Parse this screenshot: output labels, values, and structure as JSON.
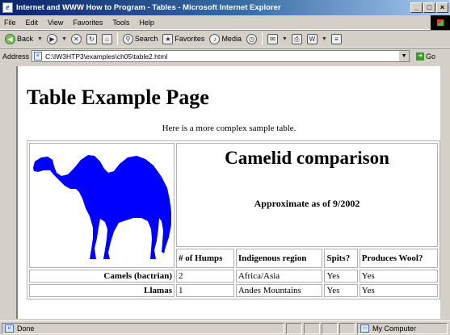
{
  "window": {
    "title": "Internet and WWW How to Program - Tables - Microsoft Internet Explorer"
  },
  "menu": [
    "File",
    "Edit",
    "View",
    "Favorites",
    "Tools",
    "Help"
  ],
  "toolbar": {
    "back": "Back",
    "search": "Search",
    "favorites": "Favorites",
    "media": "Media"
  },
  "address": {
    "label": "Address",
    "value": "C:\\IW3HTP3\\examples\\ch05\\table2.html",
    "go": "Go"
  },
  "page": {
    "heading": "Table Example Page",
    "intro": "Here is a more complex sample table.",
    "caption_title": "Camelid comparison",
    "caption_sub": "Approximate as of 9/2002",
    "headers": [
      "# of Humps",
      "Indigenous region",
      "Spits?",
      "Produces Wool?"
    ],
    "rows": [
      {
        "name": "Camels (bactrian)",
        "cells": [
          "2",
          "Africa/Asia",
          "Yes",
          "Yes"
        ]
      },
      {
        "name": "Llamas",
        "cells": [
          "1",
          "Andes Mountains",
          "Yes",
          "Yes"
        ]
      }
    ],
    "camel_color": "#0000ff"
  },
  "status": {
    "left": "Done",
    "zone": "My Computer"
  }
}
